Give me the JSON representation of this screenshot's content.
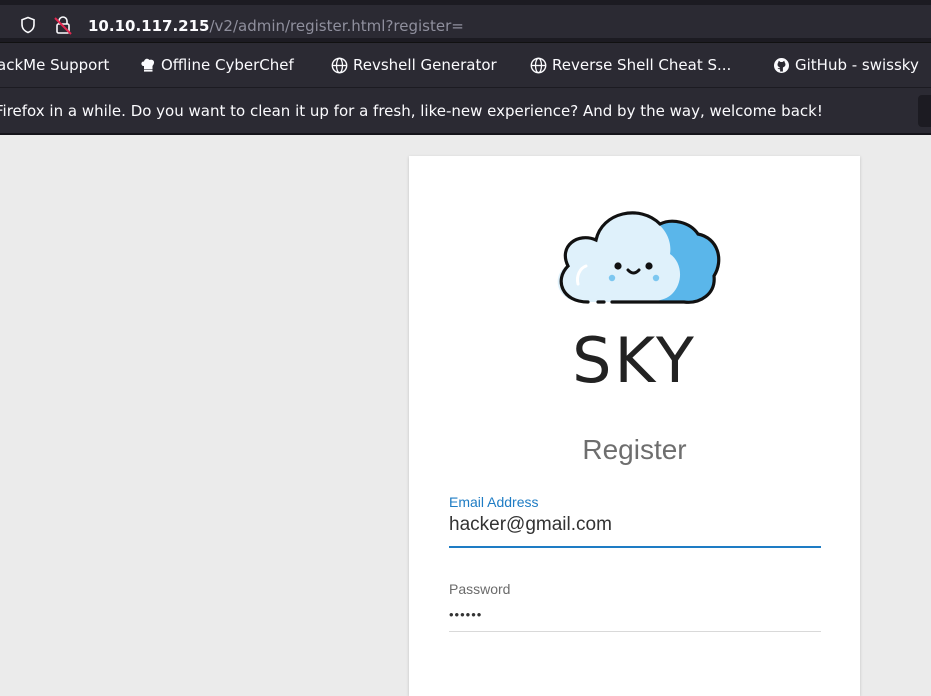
{
  "browser": {
    "url_host": "10.10.117.215",
    "url_path": "/v2/admin/register.html?register=",
    "icons": [
      "shield-icon",
      "lock-insecure-icon"
    ]
  },
  "bookmarks": [
    {
      "label": "ackMe Support",
      "icon": "none"
    },
    {
      "label": "Offline CyberChef",
      "icon": "chef-hat-icon"
    },
    {
      "label": "Revshell Generator",
      "icon": "globe-icon"
    },
    {
      "label": "Reverse Shell Cheat S...",
      "icon": "globe-icon"
    },
    {
      "label": "GitHub - swissky",
      "icon": "github-icon"
    }
  ],
  "notification": {
    "text": "Firefox in a while. Do you want to clean it up for a fresh, like-new experience? And by the way, welcome back!"
  },
  "page": {
    "brand": "SKY",
    "heading": "Register",
    "email": {
      "label": "Email Address",
      "value": "hacker@gmail.com"
    },
    "password": {
      "label": "Password",
      "value": "••••••"
    }
  },
  "colors": {
    "accent": "#1e7cc4",
    "cloud_blue": "#5ab6ea",
    "cloud_light": "#dff1fb",
    "chrome_dark": "#2b2a33"
  }
}
